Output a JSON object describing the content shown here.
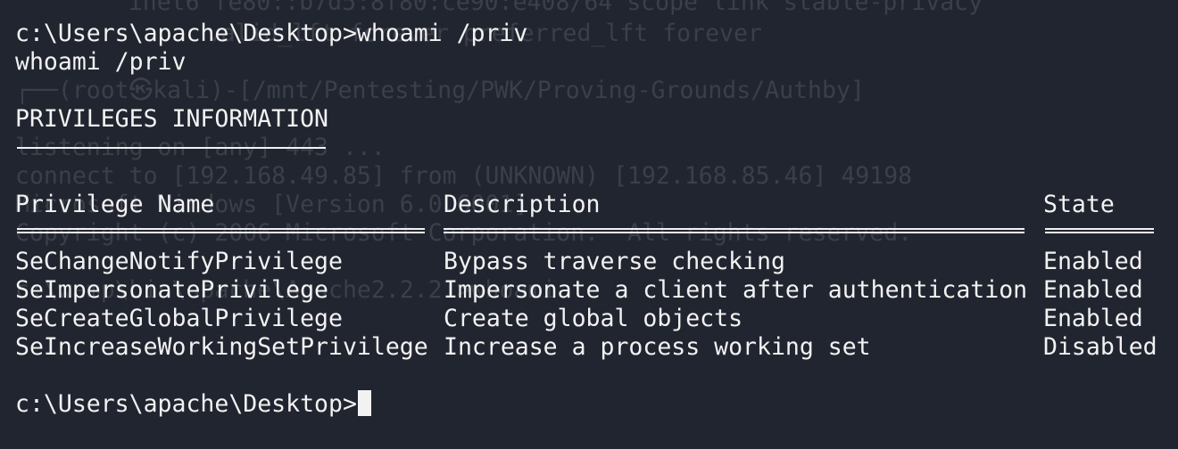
{
  "background_terminal": {
    "lines": [
      "    inet6 fe80::b7d5:8f80:ce90:e408/64 scope link stable-privacy",
      "       valid_lft forever preferred_lft forever",
      "┌──(root㉿kali)-[/mnt/Pentesting/PWK/Proving-Grounds/Authby]",
      "listening on [any] 443 ...",
      "connect to [192.168.49.85] from (UNKNOWN) [192.168.85.46] 49198",
      "Microsoft Windows [Version 6.0.6001]",
      "Copyright (c) 2006 Microsoft Corporation.  All rights reserved.",
      "c:\\wamp\\bin\\apache\\Apache2.2.21>whoami"
    ]
  },
  "terminal": {
    "prompt_1": "c:\\Users\\apache\\Desktop>whoami /priv",
    "echo": "whoami /priv",
    "section_title": "PRIVILEGES INFORMATION",
    "columns": {
      "name": "Privilege Name",
      "description": "Description",
      "state": "State"
    },
    "rows": [
      {
        "name": "SeChangeNotifyPrivilege",
        "description": "Bypass traverse checking",
        "state": "Enabled"
      },
      {
        "name": "SeImpersonatePrivilege",
        "description": "Impersonate a client after authentication",
        "state": "Enabled"
      },
      {
        "name": "SeCreateGlobalPrivilege",
        "description": "Create global objects",
        "state": "Enabled"
      },
      {
        "name": "SeIncreaseWorkingSetPrivilege",
        "description": "Increase a process working set",
        "state": "Disabled"
      }
    ],
    "prompt_2": "c:\\Users\\apache\\Desktop>"
  },
  "colors": {
    "background": "#21252f",
    "foreground": "#f2f2f2",
    "ghost_text": "#3a3f4a"
  }
}
